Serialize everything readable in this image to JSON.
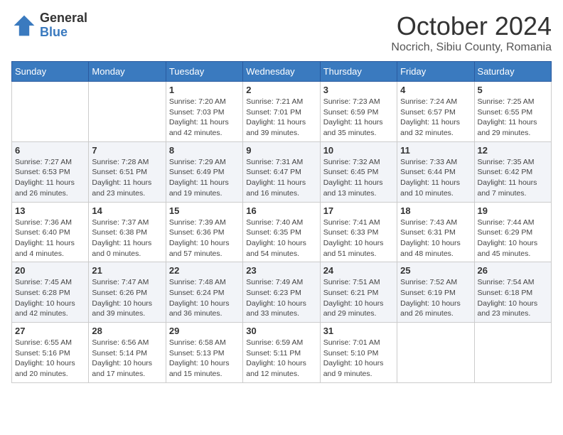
{
  "logo": {
    "general": "General",
    "blue": "Blue"
  },
  "title": {
    "month": "October 2024",
    "location": "Nocrich, Sibiu County, Romania"
  },
  "weekdays": [
    "Sunday",
    "Monday",
    "Tuesday",
    "Wednesday",
    "Thursday",
    "Friday",
    "Saturday"
  ],
  "weeks": [
    [
      {
        "day": "",
        "info": ""
      },
      {
        "day": "",
        "info": ""
      },
      {
        "day": "1",
        "info": "Sunrise: 7:20 AM\nSunset: 7:03 PM\nDaylight: 11 hours and 42 minutes."
      },
      {
        "day": "2",
        "info": "Sunrise: 7:21 AM\nSunset: 7:01 PM\nDaylight: 11 hours and 39 minutes."
      },
      {
        "day": "3",
        "info": "Sunrise: 7:23 AM\nSunset: 6:59 PM\nDaylight: 11 hours and 35 minutes."
      },
      {
        "day": "4",
        "info": "Sunrise: 7:24 AM\nSunset: 6:57 PM\nDaylight: 11 hours and 32 minutes."
      },
      {
        "day": "5",
        "info": "Sunrise: 7:25 AM\nSunset: 6:55 PM\nDaylight: 11 hours and 29 minutes."
      }
    ],
    [
      {
        "day": "6",
        "info": "Sunrise: 7:27 AM\nSunset: 6:53 PM\nDaylight: 11 hours and 26 minutes."
      },
      {
        "day": "7",
        "info": "Sunrise: 7:28 AM\nSunset: 6:51 PM\nDaylight: 11 hours and 23 minutes."
      },
      {
        "day": "8",
        "info": "Sunrise: 7:29 AM\nSunset: 6:49 PM\nDaylight: 11 hours and 19 minutes."
      },
      {
        "day": "9",
        "info": "Sunrise: 7:31 AM\nSunset: 6:47 PM\nDaylight: 11 hours and 16 minutes."
      },
      {
        "day": "10",
        "info": "Sunrise: 7:32 AM\nSunset: 6:45 PM\nDaylight: 11 hours and 13 minutes."
      },
      {
        "day": "11",
        "info": "Sunrise: 7:33 AM\nSunset: 6:44 PM\nDaylight: 11 hours and 10 minutes."
      },
      {
        "day": "12",
        "info": "Sunrise: 7:35 AM\nSunset: 6:42 PM\nDaylight: 11 hours and 7 minutes."
      }
    ],
    [
      {
        "day": "13",
        "info": "Sunrise: 7:36 AM\nSunset: 6:40 PM\nDaylight: 11 hours and 4 minutes."
      },
      {
        "day": "14",
        "info": "Sunrise: 7:37 AM\nSunset: 6:38 PM\nDaylight: 11 hours and 0 minutes."
      },
      {
        "day": "15",
        "info": "Sunrise: 7:39 AM\nSunset: 6:36 PM\nDaylight: 10 hours and 57 minutes."
      },
      {
        "day": "16",
        "info": "Sunrise: 7:40 AM\nSunset: 6:35 PM\nDaylight: 10 hours and 54 minutes."
      },
      {
        "day": "17",
        "info": "Sunrise: 7:41 AM\nSunset: 6:33 PM\nDaylight: 10 hours and 51 minutes."
      },
      {
        "day": "18",
        "info": "Sunrise: 7:43 AM\nSunset: 6:31 PM\nDaylight: 10 hours and 48 minutes."
      },
      {
        "day": "19",
        "info": "Sunrise: 7:44 AM\nSunset: 6:29 PM\nDaylight: 10 hours and 45 minutes."
      }
    ],
    [
      {
        "day": "20",
        "info": "Sunrise: 7:45 AM\nSunset: 6:28 PM\nDaylight: 10 hours and 42 minutes."
      },
      {
        "day": "21",
        "info": "Sunrise: 7:47 AM\nSunset: 6:26 PM\nDaylight: 10 hours and 39 minutes."
      },
      {
        "day": "22",
        "info": "Sunrise: 7:48 AM\nSunset: 6:24 PM\nDaylight: 10 hours and 36 minutes."
      },
      {
        "day": "23",
        "info": "Sunrise: 7:49 AM\nSunset: 6:23 PM\nDaylight: 10 hours and 33 minutes."
      },
      {
        "day": "24",
        "info": "Sunrise: 7:51 AM\nSunset: 6:21 PM\nDaylight: 10 hours and 29 minutes."
      },
      {
        "day": "25",
        "info": "Sunrise: 7:52 AM\nSunset: 6:19 PM\nDaylight: 10 hours and 26 minutes."
      },
      {
        "day": "26",
        "info": "Sunrise: 7:54 AM\nSunset: 6:18 PM\nDaylight: 10 hours and 23 minutes."
      }
    ],
    [
      {
        "day": "27",
        "info": "Sunrise: 6:55 AM\nSunset: 5:16 PM\nDaylight: 10 hours and 20 minutes."
      },
      {
        "day": "28",
        "info": "Sunrise: 6:56 AM\nSunset: 5:14 PM\nDaylight: 10 hours and 17 minutes."
      },
      {
        "day": "29",
        "info": "Sunrise: 6:58 AM\nSunset: 5:13 PM\nDaylight: 10 hours and 15 minutes."
      },
      {
        "day": "30",
        "info": "Sunrise: 6:59 AM\nSunset: 5:11 PM\nDaylight: 10 hours and 12 minutes."
      },
      {
        "day": "31",
        "info": "Sunrise: 7:01 AM\nSunset: 5:10 PM\nDaylight: 10 hours and 9 minutes."
      },
      {
        "day": "",
        "info": ""
      },
      {
        "day": "",
        "info": ""
      }
    ]
  ]
}
